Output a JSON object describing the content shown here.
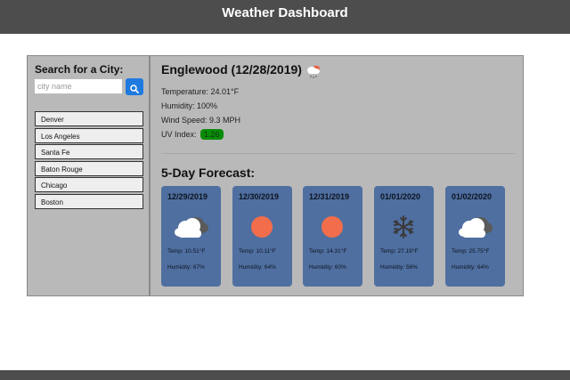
{
  "header": {
    "title": "Weather Dashboard"
  },
  "sidebar": {
    "search_title": "Search for a City:",
    "search_placeholder": "city name",
    "search_icon": "search-icon",
    "cities": [
      "Denver",
      "Los Angeles",
      "Santa Fe",
      "Baton Rouge",
      "Chicago",
      "Boston"
    ]
  },
  "current": {
    "title": "Englewood (12/28/2019)",
    "icon": "cloud-snow-icon",
    "temperature": "Temperature: 24.01°F",
    "humidity": "Humidity: 100%",
    "wind": "Wind Speed: 9.3 MPH",
    "uv_label": "UV Index:",
    "uv_value": "1.26",
    "uv_color": "#0a8c0a"
  },
  "forecast": {
    "title": "5-Day Forecast:",
    "card_color": "#4f6fa0",
    "days": [
      {
        "date": "12/29/2019",
        "icon": "cloud-icon",
        "temp": "Temp: 10.51°F",
        "humidity": "Humidity: 67%"
      },
      {
        "date": "12/30/2019",
        "icon": "sun-icon",
        "temp": "Temp: 10.11°F",
        "humidity": "Humidity: 64%"
      },
      {
        "date": "12/31/2019",
        "icon": "sun-icon",
        "temp": "Temp: 14.31°F",
        "humidity": "Humidity: 60%"
      },
      {
        "date": "01/01/2020",
        "icon": "snowflake-icon",
        "temp": "Temp: 27.19°F",
        "humidity": "Humidity: 56%"
      },
      {
        "date": "01/02/2020",
        "icon": "cloud-icon",
        "temp": "Temp: 25.75°F",
        "humidity": "Humidity: 64%"
      }
    ]
  }
}
